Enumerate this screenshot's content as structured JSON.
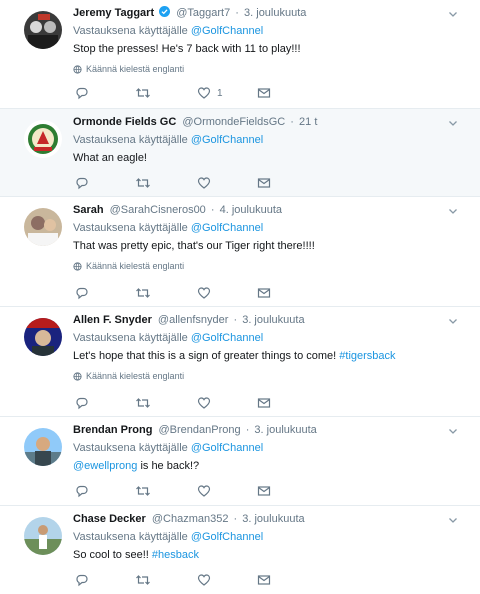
{
  "tweets": [
    {
      "name": "Jeremy Taggart",
      "verified": true,
      "handle": "@Taggart7",
      "dot": "·",
      "time": "3. joulukuuta",
      "reply_prefix": "Vastauksena käyttäjälle",
      "reply_to": "@GolfChannel",
      "text": "Stop the presses! He's 7 back with 11 to play!!!",
      "translate": "Käännä kielestä englanti",
      "like_count": "1"
    },
    {
      "name": "Ormonde Fields GC",
      "handle": "@OrmondeFieldsGC",
      "dot": "·",
      "time": "21 t",
      "reply_prefix": "Vastauksena käyttäjälle",
      "reply_to": "@GolfChannel",
      "text": "What an eagle!"
    },
    {
      "name": "Sarah",
      "handle": "@SarahCisneros00",
      "dot": "·",
      "time": "4. joulukuuta",
      "reply_prefix": "Vastauksena käyttäjälle",
      "reply_to": "@GolfChannel",
      "text": "That was pretty epic, that's our Tiger right there!!!!",
      "translate": "Käännä kielestä englanti"
    },
    {
      "name": "Allen F. Snyder",
      "handle": "@allenfsnyder",
      "dot": "·",
      "time": "3. joulukuuta",
      "reply_prefix": "Vastauksena käyttäjälle",
      "reply_to": "@GolfChannel",
      "text": "Let's hope that this is a sign of greater things to come!",
      "hashtag": "#tigersback",
      "translate": "Käännä kielestä englanti"
    },
    {
      "name": "Brendan Prong",
      "handle": "@BrendanProng",
      "dot": "·",
      "time": "3. joulukuuta",
      "reply_prefix": "Vastauksena käyttäjälle",
      "reply_to": "@GolfChannel",
      "text_mention": "@ewellprong",
      "text": "is he back!?"
    },
    {
      "name": "Chase Decker",
      "handle": "@Chazman352",
      "dot": "·",
      "time": "3. joulukuuta",
      "reply_prefix": "Vastauksena käyttäjälle",
      "reply_to": "@GolfChannel",
      "text": "So cool to see!!",
      "hashtag": "#hesback"
    }
  ],
  "icons": {
    "reply": "reply-icon",
    "retweet": "retweet-icon",
    "like": "heart-icon",
    "dm": "envelope-icon",
    "caret": "chevron-down-icon",
    "translate": "globe-icon",
    "verified": "verified-badge-icon"
  },
  "colors": {
    "link": "#1b95e0",
    "muted": "#657786",
    "text": "#14171a",
    "highlight_bg": "#f5f8fa",
    "divider": "#e6ecf0"
  }
}
